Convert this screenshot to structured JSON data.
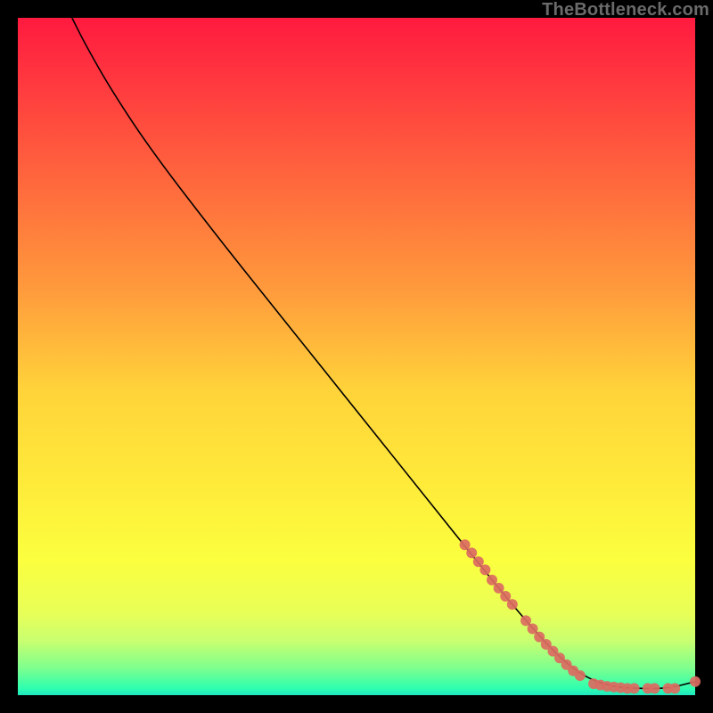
{
  "watermark": "TheBottleneck.com",
  "chart_data": {
    "type": "line",
    "title": "",
    "xlabel": "",
    "ylabel": "",
    "xlim": [
      0,
      100
    ],
    "ylim": [
      0,
      100
    ],
    "grid": false,
    "legend": false,
    "series": [
      {
        "name": "curve",
        "style": "line",
        "color": "#000000",
        "x": [
          8,
          10,
          14,
          20,
          30,
          40,
          50,
          60,
          70,
          75,
          80,
          84,
          88,
          92,
          96,
          100
        ],
        "y": [
          100,
          96,
          89,
          80,
          67,
          54.5,
          42,
          29.5,
          17,
          11,
          5.5,
          2.5,
          1.2,
          1.0,
          1.0,
          2.0
        ]
      },
      {
        "name": "dots-upper",
        "style": "scatter",
        "color": "#db6b61",
        "x": [
          66,
          67,
          68,
          69,
          70,
          71,
          72,
          73
        ],
        "y": [
          22.2,
          21.0,
          19.7,
          18.5,
          17.0,
          15.8,
          14.6,
          13.4
        ]
      },
      {
        "name": "dots-lower",
        "style": "scatter",
        "color": "#db6b61",
        "x": [
          75,
          76,
          77,
          78,
          79,
          80,
          81,
          82,
          83
        ],
        "y": [
          11.0,
          9.8,
          8.6,
          7.5,
          6.5,
          5.5,
          4.5,
          3.6,
          2.9
        ]
      },
      {
        "name": "dots-flat",
        "style": "scatter",
        "color": "#db6b61",
        "x": [
          85,
          86,
          87,
          88,
          89,
          90,
          91,
          93,
          94,
          96,
          97,
          100
        ],
        "y": [
          1.7,
          1.5,
          1.3,
          1.2,
          1.1,
          1.0,
          1.0,
          1.0,
          1.0,
          1.0,
          1.0,
          2.0
        ]
      }
    ]
  }
}
